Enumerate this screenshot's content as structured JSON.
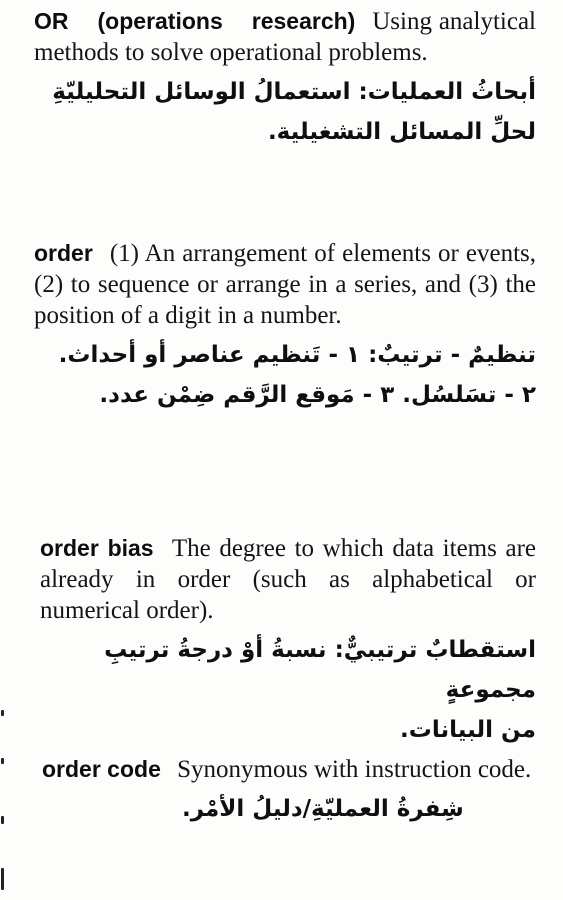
{
  "entries": [
    {
      "term": "OR (operations research)",
      "definition_en": "Using analytical methods to solve operational problems.",
      "definition_ar_lines": [
        "أبحاثُ العمليات: استعمالُ الوسائل التحليليّةِ",
        "لحلِّ المسائل التشغيلية."
      ]
    },
    {
      "term": "order",
      "definition_en": "(1) An arrangement of elements or events, (2) to sequence or arrange in a series, and (3) the position of a digit in a number.",
      "definition_ar_lines": [
        "تنظيمٌ - ترتيبٌ: ١ - تَنظيم عناصر أو أحداث.",
        "٢ - تسَلسُل. ٣ - مَوقع الرَّقم ضِمْن عدد."
      ]
    },
    {
      "term": "order bias",
      "definition_en": "The degree to which data items are already in order (such as alphabetical or numerical order).",
      "definition_ar_lines": [
        "استقطابٌ ترتيبيٌّ: نسبةُ أوْ درجةُ ترتيبِ مجموعةٍ",
        "من البيانات."
      ]
    },
    {
      "term": "order code",
      "definition_en": "Synonymous with instruction code.",
      "definition_ar_lines": [
        "شِفرةُ العمليّةِ/دليلُ الأمْر."
      ]
    }
  ]
}
